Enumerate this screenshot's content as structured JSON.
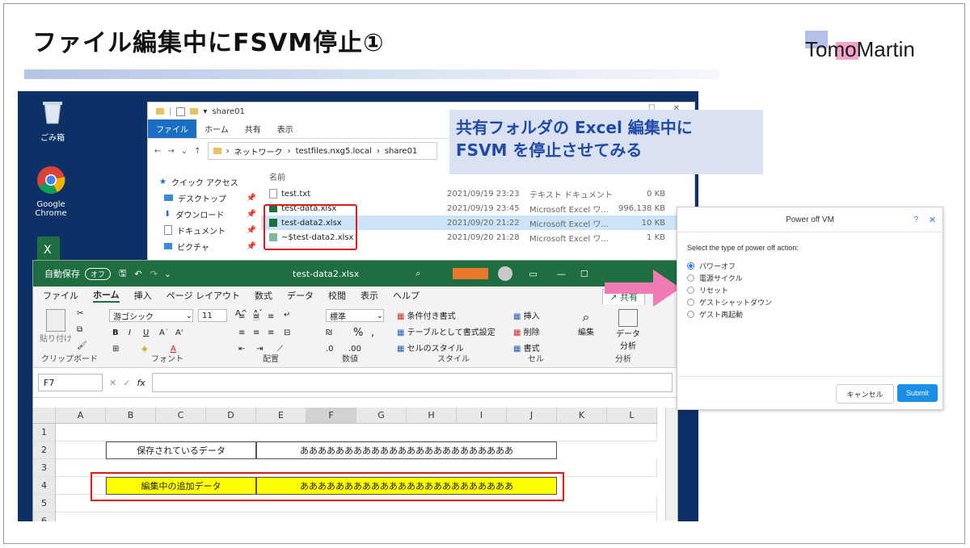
{
  "slide": {
    "title": "ファイル編集中にFSVM停止①",
    "logo": "TomoMartin",
    "callout_line1": "共有フォルダの Excel 編集中に",
    "callout_line2": "FSVM を停止させてみる"
  },
  "desktop": {
    "icons": [
      {
        "label": "ごみ箱",
        "icon": "recycle-bin-icon"
      },
      {
        "label": "Google Chrome",
        "icon": "chrome-icon"
      }
    ]
  },
  "explorer": {
    "window_title": "share01",
    "ribbon_tabs": [
      "ファイル",
      "ホーム",
      "共有",
      "表示"
    ],
    "address_path": [
      "ネットワーク",
      "testfiles.nxg5.local",
      "share01"
    ],
    "nav_items": [
      {
        "label": "クイック アクセス",
        "icon": "star-icon"
      },
      {
        "label": "デスクトップ",
        "icon": "desktop-icon"
      },
      {
        "label": "ダウンロード",
        "icon": "download-icon"
      },
      {
        "label": "ドキュメント",
        "icon": "document-icon"
      },
      {
        "label": "ピクチャ",
        "icon": "picture-icon"
      }
    ],
    "column_name": "名前",
    "files": [
      {
        "name": "test.txt",
        "date": "2021/09/19 23:23",
        "type": "テキスト ドキュメント",
        "size": "0 KB",
        "icon": "text-file-icon"
      },
      {
        "name": "test-data.xlsx",
        "date": "2021/09/19 23:45",
        "type": "Microsoft Excel ワ...",
        "size": "996,138 KB",
        "icon": "excel-file-icon"
      },
      {
        "name": "test-data2.xlsx",
        "date": "2021/09/20 21:22",
        "type": "Microsoft Excel ワ...",
        "size": "10 KB",
        "icon": "excel-file-icon"
      },
      {
        "name": "~$test-data2.xlsx",
        "date": "2021/09/20 21:28",
        "type": "Microsoft Excel ワ...",
        "size": "1 KB",
        "icon": "excel-file-icon"
      }
    ]
  },
  "excel": {
    "autosave_label": "自動保存",
    "autosave_state": "オフ",
    "file_title": "test-data2.xlsx",
    "tabs": [
      "ファイル",
      "ホーム",
      "挿入",
      "ページ レイアウト",
      "数式",
      "データ",
      "校閲",
      "表示",
      "ヘルプ"
    ],
    "share_label": "共有",
    "font_name": "游ゴシック",
    "font_size": "11",
    "number_format": "標準",
    "ribbon_groups": [
      "クリップボード",
      "フォント",
      "配置",
      "数値",
      "スタイル",
      "セル",
      "分析"
    ],
    "paste_label": "貼り付け",
    "style_items": [
      "条件付き書式",
      "テーブルとして書式設定",
      "セルのスタイル"
    ],
    "cell_items": [
      "挿入",
      "削除",
      "書式"
    ],
    "edit_label": "編集",
    "analyze_label": "データ 分析",
    "name_box": "F7",
    "columns": [
      "A",
      "B",
      "C",
      "D",
      "E",
      "F",
      "G",
      "H",
      "I",
      "J",
      "K",
      "L"
    ],
    "rows": [
      "1",
      "2",
      "3",
      "4",
      "5",
      "6"
    ],
    "row2_label": "保存されているデータ",
    "row2_value": "ああああああああああああああああああああああああ",
    "row4_label": "編集中の追加データ",
    "row4_value": "ああああああああああああああああああああああああ"
  },
  "vm_dialog": {
    "title": "Power off VM",
    "help": "?",
    "prompt": "Select the type of power off action:",
    "options": [
      "パワーオフ",
      "電源サイクル",
      "リセット",
      "ゲストシャットダウン",
      "ゲスト再起動"
    ],
    "selected_index": 0,
    "cancel_label": "キャンセル",
    "submit_label": "Submit"
  },
  "colors": {
    "accent_pink": "#f27ab5",
    "highlight_red": "#e01818",
    "excel_green": "#1e6e42",
    "nutanix_blue": "#1b8fe8"
  }
}
